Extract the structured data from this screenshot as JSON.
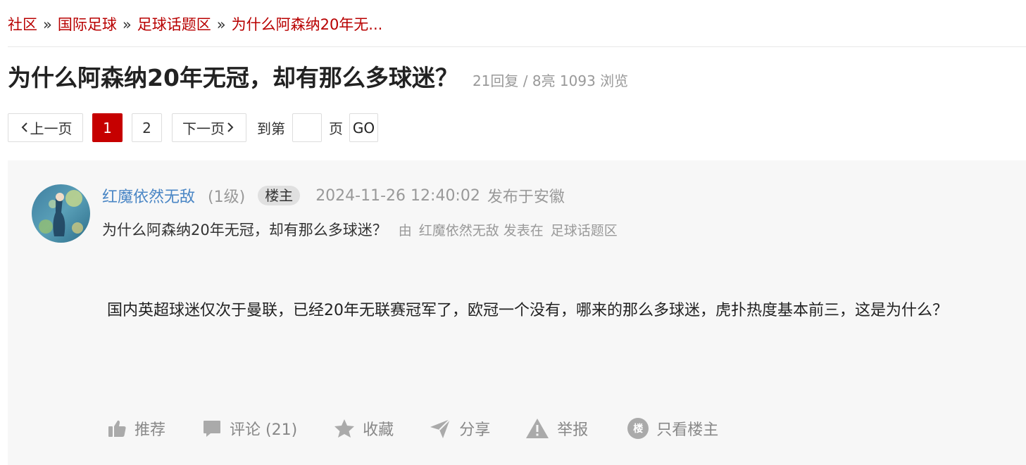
{
  "breadcrumb": {
    "items": [
      "社区",
      "国际足球",
      "足球话题区",
      "为什么阿森纳20年无..."
    ],
    "separator": "»"
  },
  "thread": {
    "title": "为什么阿森纳20年无冠，却有那么多球迷？",
    "stats": "21回复 / 8亮 1093 浏览"
  },
  "pagination": {
    "prev_label": "上一页",
    "next_label": "下一页",
    "pages": [
      "1",
      "2"
    ],
    "current_page": "1",
    "goto_label": "到第",
    "page_label": "页",
    "goto_input_value": "",
    "go_label": "GO"
  },
  "post": {
    "author": "红魔依然无敌",
    "level": "(1级)",
    "op_badge": "楼主",
    "time": "2024-11-26 12:40:02",
    "location": "发布于安徽",
    "sub_title": "为什么阿森纳20年无冠，却有那么多球迷？",
    "sub_by": "由",
    "sub_author": "红魔依然无敌",
    "sub_posted_in": "发表在",
    "sub_forum": "足球话题区",
    "content": "国内英超球迷仅次于曼联，已经20年无联赛冠军了，欧冠一个没有，哪来的那么多球迷，虎扑热度基本前三，这是为什么？"
  },
  "actions": {
    "recommend": "推荐",
    "comment": "评论 (21)",
    "favorite": "收藏",
    "share": "分享",
    "report": "举报",
    "only_op": "只看楼主",
    "only_op_icon_char": "楼"
  },
  "colors": {
    "link_red": "#b80000",
    "active_page": "#c60000",
    "author_blue": "#4a86c5",
    "muted": "#999999",
    "panel_bg": "#f7f7f7"
  },
  "icons": {
    "avatar": "avatar-image",
    "recommend": "thumbs-up-icon",
    "comment": "comment-bubble-icon",
    "favorite": "star-icon",
    "share": "paper-plane-icon",
    "report": "warning-icon",
    "only_op": "lou-badge-icon",
    "prev": "chevron-left-icon",
    "next": "chevron-right-icon"
  }
}
